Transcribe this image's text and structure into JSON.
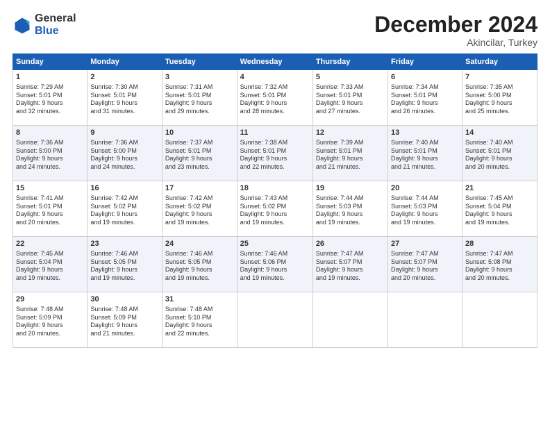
{
  "logo": {
    "general": "General",
    "blue": "Blue"
  },
  "header": {
    "month_title": "December 2024",
    "subtitle": "Akincilar, Turkey"
  },
  "weekdays": [
    "Sunday",
    "Monday",
    "Tuesday",
    "Wednesday",
    "Thursday",
    "Friday",
    "Saturday"
  ],
  "weeks": [
    [
      {
        "day": "1",
        "lines": [
          "Sunrise: 7:29 AM",
          "Sunset: 5:01 PM",
          "Daylight: 9 hours",
          "and 32 minutes."
        ]
      },
      {
        "day": "2",
        "lines": [
          "Sunrise: 7:30 AM",
          "Sunset: 5:01 PM",
          "Daylight: 9 hours",
          "and 31 minutes."
        ]
      },
      {
        "day": "3",
        "lines": [
          "Sunrise: 7:31 AM",
          "Sunset: 5:01 PM",
          "Daylight: 9 hours",
          "and 29 minutes."
        ]
      },
      {
        "day": "4",
        "lines": [
          "Sunrise: 7:32 AM",
          "Sunset: 5:01 PM",
          "Daylight: 9 hours",
          "and 28 minutes."
        ]
      },
      {
        "day": "5",
        "lines": [
          "Sunrise: 7:33 AM",
          "Sunset: 5:01 PM",
          "Daylight: 9 hours",
          "and 27 minutes."
        ]
      },
      {
        "day": "6",
        "lines": [
          "Sunrise: 7:34 AM",
          "Sunset: 5:01 PM",
          "Daylight: 9 hours",
          "and 26 minutes."
        ]
      },
      {
        "day": "7",
        "lines": [
          "Sunrise: 7:35 AM",
          "Sunset: 5:00 PM",
          "Daylight: 9 hours",
          "and 25 minutes."
        ]
      }
    ],
    [
      {
        "day": "8",
        "lines": [
          "Sunrise: 7:36 AM",
          "Sunset: 5:00 PM",
          "Daylight: 9 hours",
          "and 24 minutes."
        ]
      },
      {
        "day": "9",
        "lines": [
          "Sunrise: 7:36 AM",
          "Sunset: 5:00 PM",
          "Daylight: 9 hours",
          "and 24 minutes."
        ]
      },
      {
        "day": "10",
        "lines": [
          "Sunrise: 7:37 AM",
          "Sunset: 5:01 PM",
          "Daylight: 9 hours",
          "and 23 minutes."
        ]
      },
      {
        "day": "11",
        "lines": [
          "Sunrise: 7:38 AM",
          "Sunset: 5:01 PM",
          "Daylight: 9 hours",
          "and 22 minutes."
        ]
      },
      {
        "day": "12",
        "lines": [
          "Sunrise: 7:39 AM",
          "Sunset: 5:01 PM",
          "Daylight: 9 hours",
          "and 21 minutes."
        ]
      },
      {
        "day": "13",
        "lines": [
          "Sunrise: 7:40 AM",
          "Sunset: 5:01 PM",
          "Daylight: 9 hours",
          "and 21 minutes."
        ]
      },
      {
        "day": "14",
        "lines": [
          "Sunrise: 7:40 AM",
          "Sunset: 5:01 PM",
          "Daylight: 9 hours",
          "and 20 minutes."
        ]
      }
    ],
    [
      {
        "day": "15",
        "lines": [
          "Sunrise: 7:41 AM",
          "Sunset: 5:01 PM",
          "Daylight: 9 hours",
          "and 20 minutes."
        ]
      },
      {
        "day": "16",
        "lines": [
          "Sunrise: 7:42 AM",
          "Sunset: 5:02 PM",
          "Daylight: 9 hours",
          "and 19 minutes."
        ]
      },
      {
        "day": "17",
        "lines": [
          "Sunrise: 7:42 AM",
          "Sunset: 5:02 PM",
          "Daylight: 9 hours",
          "and 19 minutes."
        ]
      },
      {
        "day": "18",
        "lines": [
          "Sunrise: 7:43 AM",
          "Sunset: 5:02 PM",
          "Daylight: 9 hours",
          "and 19 minutes."
        ]
      },
      {
        "day": "19",
        "lines": [
          "Sunrise: 7:44 AM",
          "Sunset: 5:03 PM",
          "Daylight: 9 hours",
          "and 19 minutes."
        ]
      },
      {
        "day": "20",
        "lines": [
          "Sunrise: 7:44 AM",
          "Sunset: 5:03 PM",
          "Daylight: 9 hours",
          "and 19 minutes."
        ]
      },
      {
        "day": "21",
        "lines": [
          "Sunrise: 7:45 AM",
          "Sunset: 5:04 PM",
          "Daylight: 9 hours",
          "and 19 minutes."
        ]
      }
    ],
    [
      {
        "day": "22",
        "lines": [
          "Sunrise: 7:45 AM",
          "Sunset: 5:04 PM",
          "Daylight: 9 hours",
          "and 19 minutes."
        ]
      },
      {
        "day": "23",
        "lines": [
          "Sunrise: 7:46 AM",
          "Sunset: 5:05 PM",
          "Daylight: 9 hours",
          "and 19 minutes."
        ]
      },
      {
        "day": "24",
        "lines": [
          "Sunrise: 7:46 AM",
          "Sunset: 5:05 PM",
          "Daylight: 9 hours",
          "and 19 minutes."
        ]
      },
      {
        "day": "25",
        "lines": [
          "Sunrise: 7:46 AM",
          "Sunset: 5:06 PM",
          "Daylight: 9 hours",
          "and 19 minutes."
        ]
      },
      {
        "day": "26",
        "lines": [
          "Sunrise: 7:47 AM",
          "Sunset: 5:07 PM",
          "Daylight: 9 hours",
          "and 19 minutes."
        ]
      },
      {
        "day": "27",
        "lines": [
          "Sunrise: 7:47 AM",
          "Sunset: 5:07 PM",
          "Daylight: 9 hours",
          "and 20 minutes."
        ]
      },
      {
        "day": "28",
        "lines": [
          "Sunrise: 7:47 AM",
          "Sunset: 5:08 PM",
          "Daylight: 9 hours",
          "and 20 minutes."
        ]
      }
    ],
    [
      {
        "day": "29",
        "lines": [
          "Sunrise: 7:48 AM",
          "Sunset: 5:09 PM",
          "Daylight: 9 hours",
          "and 20 minutes."
        ]
      },
      {
        "day": "30",
        "lines": [
          "Sunrise: 7:48 AM",
          "Sunset: 5:09 PM",
          "Daylight: 9 hours",
          "and 21 minutes."
        ]
      },
      {
        "day": "31",
        "lines": [
          "Sunrise: 7:48 AM",
          "Sunset: 5:10 PM",
          "Daylight: 9 hours",
          "and 22 minutes."
        ]
      },
      null,
      null,
      null,
      null
    ]
  ]
}
